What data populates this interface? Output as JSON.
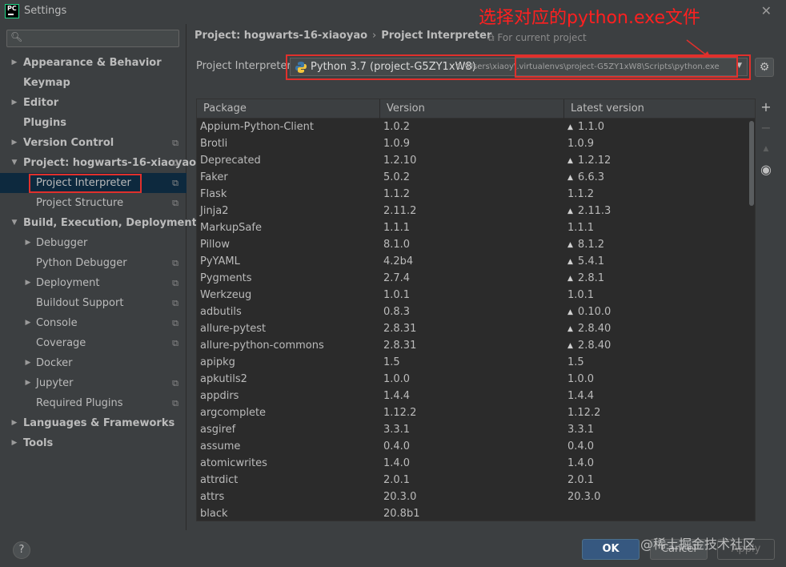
{
  "window": {
    "title": "Settings",
    "app_logo": "PC"
  },
  "annotation": {
    "text": "选择对应的python.exe文件"
  },
  "sidebar": {
    "search_placeholder": "",
    "items": [
      {
        "label": "Appearance & Behavior",
        "expandable": true
      },
      {
        "label": "Keymap",
        "expandable": false
      },
      {
        "label": "Editor",
        "expandable": true
      },
      {
        "label": "Plugins",
        "expandable": false
      },
      {
        "label": "Version Control",
        "expandable": true
      },
      {
        "label": "Project: hogwarts-16-xiaoyao",
        "expanded": true
      },
      {
        "label": "Project Interpreter",
        "selected": true
      },
      {
        "label": "Project Structure"
      },
      {
        "label": "Build, Execution, Deployment",
        "expanded": true
      },
      {
        "label": "Debugger",
        "expandable": true
      },
      {
        "label": "Python Debugger"
      },
      {
        "label": "Deployment",
        "expandable": true
      },
      {
        "label": "Buildout Support"
      },
      {
        "label": "Console",
        "expandable": true
      },
      {
        "label": "Coverage"
      },
      {
        "label": "Docker",
        "expandable": true
      },
      {
        "label": "Jupyter",
        "expandable": true
      },
      {
        "label": "Required Plugins"
      },
      {
        "label": "Languages & Frameworks",
        "expandable": true
      },
      {
        "label": "Tools",
        "expandable": true
      }
    ]
  },
  "header": {
    "breadcrumb_project": "Project: hogwarts-16-xiaoyao",
    "breadcrumb_sep": "›",
    "breadcrumb_page": "Project Interpreter",
    "for_current": "For current project"
  },
  "interpreter": {
    "label": "Project Interpreter:",
    "name": "Python 3.7 (project-G5ZY1xW8)",
    "path": "C:\\Users\\xiaoy\\.virtualenvs\\project-G5ZY1xW8\\Scripts\\python.exe"
  },
  "table": {
    "headers": [
      "Package",
      "Version",
      "Latest version"
    ],
    "rows": [
      {
        "package": "Appium-Python-Client",
        "version": "1.0.2",
        "latest": "1.1.0",
        "upgrade": true
      },
      {
        "package": "Brotli",
        "version": "1.0.9",
        "latest": "1.0.9",
        "upgrade": false
      },
      {
        "package": "Deprecated",
        "version": "1.2.10",
        "latest": "1.2.12",
        "upgrade": true
      },
      {
        "package": "Faker",
        "version": "5.0.2",
        "latest": "6.6.3",
        "upgrade": true
      },
      {
        "package": "Flask",
        "version": "1.1.2",
        "latest": "1.1.2",
        "upgrade": false
      },
      {
        "package": "Jinja2",
        "version": "2.11.2",
        "latest": "2.11.3",
        "upgrade": true
      },
      {
        "package": "MarkupSafe",
        "version": "1.1.1",
        "latest": "1.1.1",
        "upgrade": false
      },
      {
        "package": "Pillow",
        "version": "8.1.0",
        "latest": "8.1.2",
        "upgrade": true
      },
      {
        "package": "PyYAML",
        "version": "4.2b4",
        "latest": "5.4.1",
        "upgrade": true
      },
      {
        "package": "Pygments",
        "version": "2.7.4",
        "latest": "2.8.1",
        "upgrade": true
      },
      {
        "package": "Werkzeug",
        "version": "1.0.1",
        "latest": "1.0.1",
        "upgrade": false
      },
      {
        "package": "adbutils",
        "version": "0.8.3",
        "latest": "0.10.0",
        "upgrade": true
      },
      {
        "package": "allure-pytest",
        "version": "2.8.31",
        "latest": "2.8.40",
        "upgrade": true
      },
      {
        "package": "allure-python-commons",
        "version": "2.8.31",
        "latest": "2.8.40",
        "upgrade": true
      },
      {
        "package": "apipkg",
        "version": "1.5",
        "latest": "1.5",
        "upgrade": false
      },
      {
        "package": "apkutils2",
        "version": "1.0.0",
        "latest": "1.0.0",
        "upgrade": false
      },
      {
        "package": "appdirs",
        "version": "1.4.4",
        "latest": "1.4.4",
        "upgrade": false
      },
      {
        "package": "argcomplete",
        "version": "1.12.2",
        "latest": "1.12.2",
        "upgrade": false
      },
      {
        "package": "asgiref",
        "version": "3.3.1",
        "latest": "3.3.1",
        "upgrade": false
      },
      {
        "package": "assume",
        "version": "0.4.0",
        "latest": "0.4.0",
        "upgrade": false
      },
      {
        "package": "atomicwrites",
        "version": "1.4.0",
        "latest": "1.4.0",
        "upgrade": false
      },
      {
        "package": "attrdict",
        "version": "2.0.1",
        "latest": "2.0.1",
        "upgrade": false
      },
      {
        "package": "attrs",
        "version": "20.3.0",
        "latest": "20.3.0",
        "upgrade": false
      },
      {
        "package": "black",
        "version": "20.8b1",
        "latest": "",
        "upgrade": false
      }
    ]
  },
  "side_tools": [
    {
      "icon": "plus-icon",
      "glyph": "+"
    },
    {
      "icon": "minus-icon",
      "glyph": "−"
    },
    {
      "icon": "upgrade-icon",
      "glyph": "▲"
    },
    {
      "icon": "eye-icon",
      "glyph": "◉"
    }
  ],
  "footer": {
    "help": "?",
    "ok": "OK",
    "cancel": "Cancel",
    "apply": "Apply",
    "watermark": "@稀土掘金技术社区"
  }
}
